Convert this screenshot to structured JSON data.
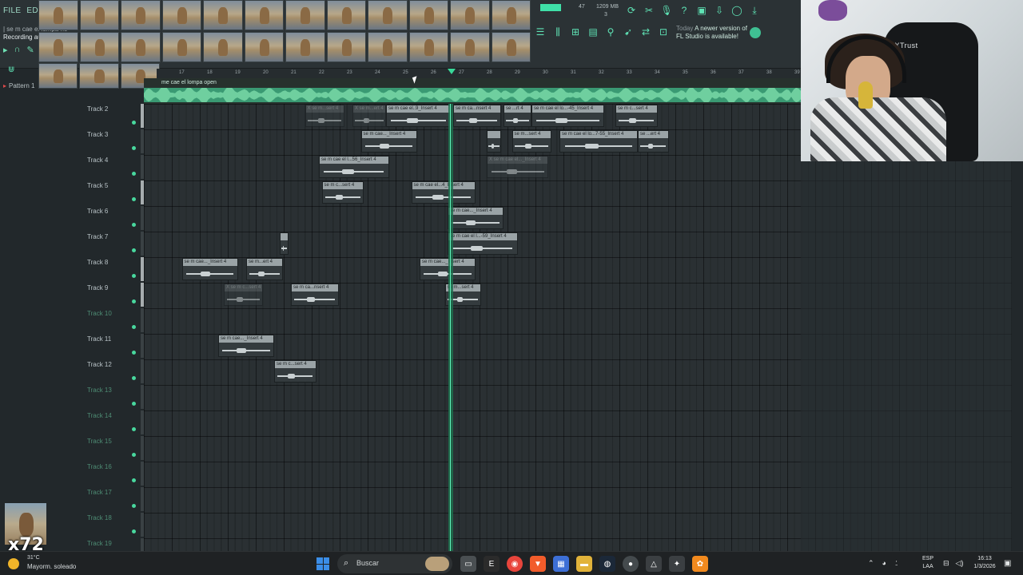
{
  "menu": [
    "FILE",
    "EDIT",
    "AD"
  ],
  "hint": {
    "line1": "| se m cae el lompa no",
    "line2": "Recording au"
  },
  "monitor": {
    "cpu_value": "47",
    "memory": "1209 MB",
    "polyphony": "3"
  },
  "news": {
    "date": "Today",
    "text_line1": "A newer version of",
    "text_line2": "FL Studio is available!"
  },
  "pattern_label": "Pattern 1",
  "ruler_ticks": [
    "17",
    "18",
    "19",
    "20",
    "21",
    "22",
    "23",
    "24",
    "25",
    "26",
    "27",
    "28",
    "29",
    "30",
    "31",
    "32",
    "33",
    "34",
    "35",
    "36",
    "37",
    "38",
    "39"
  ],
  "audio_clip_label": "me cae el lompa open",
  "tracks": [
    {
      "name": "Track 2",
      "muted": false
    },
    {
      "name": "Track 3",
      "muted": false
    },
    {
      "name": "Track 4",
      "muted": false
    },
    {
      "name": "Track 5",
      "muted": false
    },
    {
      "name": "Track 6",
      "muted": false
    },
    {
      "name": "Track 7",
      "muted": false
    },
    {
      "name": "Track 8",
      "muted": false
    },
    {
      "name": "Track 9",
      "muted": false
    },
    {
      "name": "Track 10",
      "muted": true
    },
    {
      "name": "Track 11",
      "muted": false
    },
    {
      "name": "Track 12",
      "muted": false
    },
    {
      "name": "Track 13",
      "muted": true
    },
    {
      "name": "Track 14",
      "muted": true
    },
    {
      "name": "Track 15",
      "muted": true
    },
    {
      "name": "Track 16",
      "muted": true
    },
    {
      "name": "Track 17",
      "muted": true
    },
    {
      "name": "Track 18",
      "muted": true
    },
    {
      "name": "Track 19",
      "muted": true
    }
  ],
  "clips": [
    {
      "track": 0,
      "start_bar": 21.5,
      "length_bars": 1.4,
      "label": "X se m...sert 4",
      "muted": true
    },
    {
      "track": 0,
      "start_bar": 23.2,
      "length_bars": 1.2,
      "label": "X se m...ert 4",
      "muted": true
    },
    {
      "track": 0,
      "start_bar": 24.4,
      "length_bars": 2.3,
      "label": "se m cae el..9_Insert 4",
      "muted": false
    },
    {
      "track": 0,
      "start_bar": 26.8,
      "length_bars": 1.7,
      "label": "se m ca...nsert 4",
      "muted": false
    },
    {
      "track": 0,
      "start_bar": 28.6,
      "length_bars": 1.0,
      "label": "se ...rt 4",
      "muted": false
    },
    {
      "track": 0,
      "start_bar": 29.6,
      "length_bars": 2.6,
      "label": "se m cae el lo...-45_Insert 4",
      "muted": false
    },
    {
      "track": 0,
      "start_bar": 32.6,
      "length_bars": 1.5,
      "label": "se m c...sert 4",
      "muted": false
    },
    {
      "track": 1,
      "start_bar": 23.5,
      "length_bars": 2.0,
      "label": "se m cae..._Insert 4",
      "muted": false
    },
    {
      "track": 1,
      "start_bar": 28.0,
      "length_bars": 0.5,
      "label": "",
      "muted": false
    },
    {
      "track": 1,
      "start_bar": 28.9,
      "length_bars": 1.4,
      "label": "se m...sert 4",
      "muted": false
    },
    {
      "track": 1,
      "start_bar": 30.6,
      "length_bars": 2.8,
      "label": "se m cae el lo...7-55_Insert 4",
      "muted": false
    },
    {
      "track": 1,
      "start_bar": 33.4,
      "length_bars": 1.1,
      "label": "se ...ert 4",
      "muted": false
    },
    {
      "track": 2,
      "start_bar": 22.0,
      "length_bars": 2.5,
      "label": "se m cae el l...56_Insert 4",
      "muted": false
    },
    {
      "track": 2,
      "start_bar": 28.0,
      "length_bars": 2.2,
      "label": "X se m cae el..._Insert 4",
      "muted": true
    },
    {
      "track": 3,
      "start_bar": 22.1,
      "length_bars": 1.5,
      "label": "se m c...sert 4",
      "muted": false
    },
    {
      "track": 3,
      "start_bar": 25.3,
      "length_bars": 2.3,
      "label": "se m cae el...4_Insert 4",
      "muted": false
    },
    {
      "track": 4,
      "start_bar": 26.6,
      "length_bars": 2.0,
      "label": "se m cae..._Insert 4",
      "muted": false
    },
    {
      "track": 5,
      "start_bar": 20.6,
      "length_bars": 0.3,
      "label": "",
      "muted": false
    },
    {
      "track": 5,
      "start_bar": 26.6,
      "length_bars": 2.5,
      "label": "se m cae el l...-59_Insert 4",
      "muted": false
    },
    {
      "track": 6,
      "start_bar": 17.1,
      "length_bars": 2.0,
      "label": "se m cae..._Insert 4",
      "muted": false
    },
    {
      "track": 6,
      "start_bar": 19.4,
      "length_bars": 1.3,
      "label": "se m...ert 4",
      "muted": false
    },
    {
      "track": 6,
      "start_bar": 25.6,
      "length_bars": 2.0,
      "label": "se m cae..._Insert 4",
      "muted": false
    },
    {
      "track": 7,
      "start_bar": 18.6,
      "length_bars": 1.4,
      "label": "X se m c...sert 4",
      "muted": true
    },
    {
      "track": 7,
      "start_bar": 21.0,
      "length_bars": 1.7,
      "label": "se m ca...nsert 4",
      "muted": false
    },
    {
      "track": 7,
      "start_bar": 26.5,
      "length_bars": 1.3,
      "label": "se m...sert 4",
      "muted": false
    },
    {
      "track": 9,
      "start_bar": 18.4,
      "length_bars": 2.0,
      "label": "se m cae..._Insert 4",
      "muted": false
    },
    {
      "track": 10,
      "start_bar": 20.4,
      "length_bars": 1.5,
      "label": "se m c...sert 4",
      "muted": false
    }
  ],
  "webcam": {
    "chair_brand": "GXTrust"
  },
  "overlay_count": "x72",
  "weather": {
    "temp": "31°C",
    "desc": "Mayorm. soleado"
  },
  "taskbar": {
    "search_placeholder": "Buscar"
  },
  "lang": {
    "line1": "ESP",
    "line2": "LAA"
  },
  "clock": {
    "time": "16:13",
    "date": "1/3/2026"
  },
  "colors": {
    "accent": "#5fe3b5",
    "playhead": "#5ff0b8",
    "background": "#2a3033"
  }
}
